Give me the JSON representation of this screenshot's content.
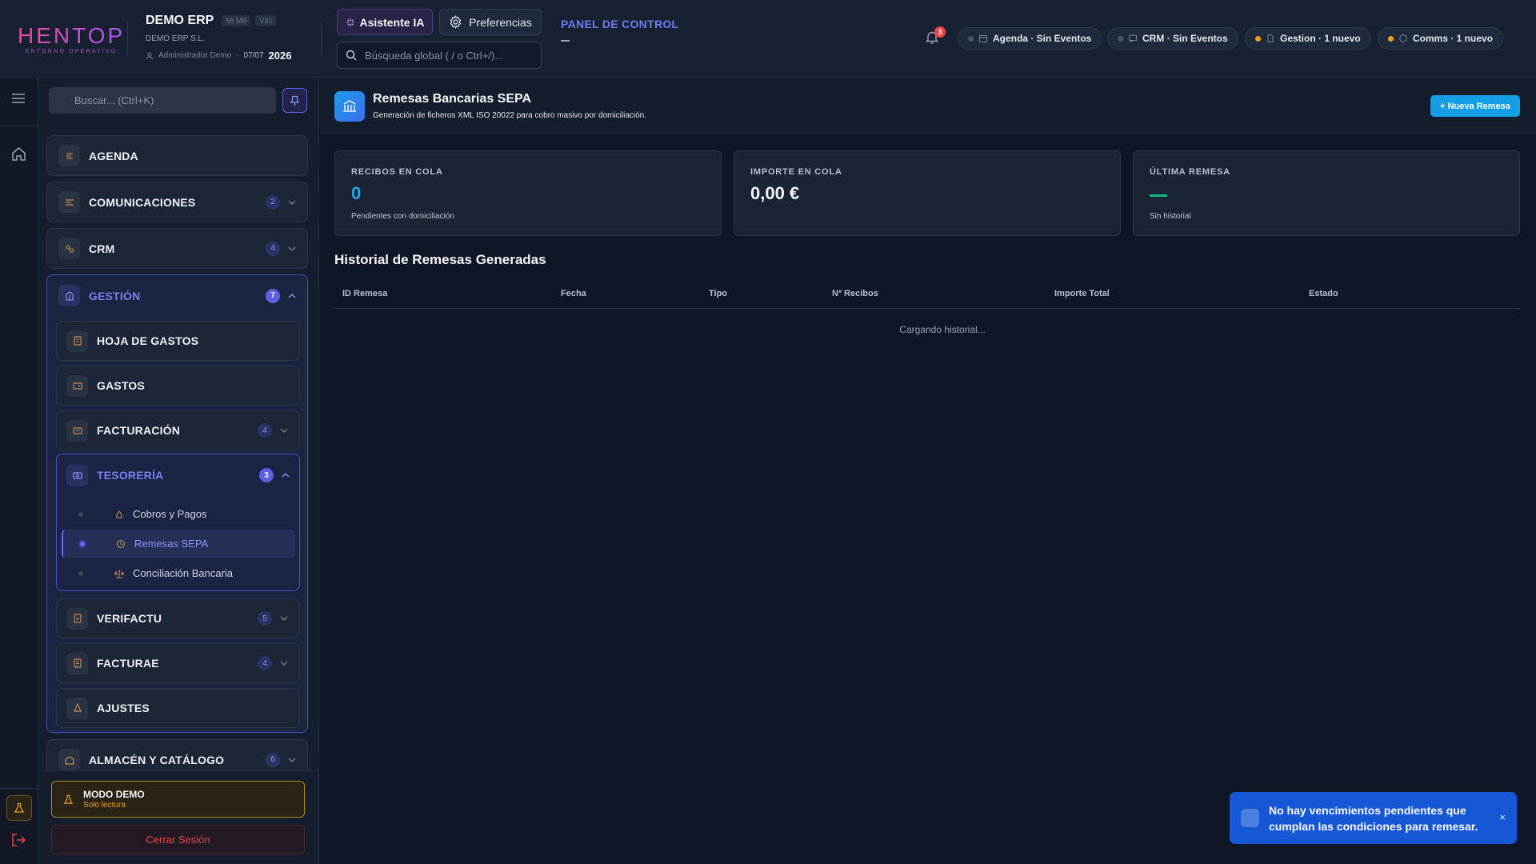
{
  "header": {
    "logo_text": "HENTOP",
    "logo_sub": "ENTORNO OPERATIVO",
    "company_name": "DEMO ERP",
    "size_tag": "58 MB",
    "version_tag": "V31",
    "legal_name": "DEMO ERP S.L.",
    "user": "Administrador Demo",
    "date": "07/07",
    "year": "2026",
    "ai_button": "Asistente IA",
    "prefs_button": "Preferencias",
    "search_placeholder": "Búsqueda global ( / o Ctrl+/)...",
    "panel_link": "PANEL DE CONTROL",
    "notif_count": "3",
    "pills": [
      {
        "label": "Agenda · Sin Eventos",
        "status": "idle"
      },
      {
        "label": "CRM · Sin Eventos",
        "status": "idle"
      },
      {
        "label": "Gestion · 1 nuevo",
        "status": "new"
      },
      {
        "label": "Comms · 1 nuevo",
        "status": "new"
      }
    ]
  },
  "sidebar": {
    "search_placeholder": "Buscar... (Ctrl+K)",
    "items": [
      {
        "label": "AGENDA",
        "count": ""
      },
      {
        "label": "COMUNICACIONES",
        "count": "2"
      },
      {
        "label": "CRM",
        "count": "4"
      }
    ],
    "gestion": {
      "label": "GESTIÓN",
      "count": "7",
      "children": [
        {
          "label": "HOJA DE GASTOS",
          "count": ""
        },
        {
          "label": "GASTOS",
          "count": ""
        },
        {
          "label": "FACTURACIÓN",
          "count": "4"
        }
      ],
      "tesoreria": {
        "label": "TESORERÍA",
        "count": "3",
        "leaves": [
          "Cobros y Pagos",
          "Remesas SEPA",
          "Conciliación Bancaria"
        ]
      },
      "after": [
        {
          "label": "VERIFACTU",
          "count": "5"
        },
        {
          "label": "FACTURAE",
          "count": "4"
        },
        {
          "label": "AJUSTES",
          "count": ""
        }
      ]
    },
    "almacen": {
      "label": "ALMACÉN Y CATÁLOGO",
      "count": "6"
    },
    "demo_title": "MODO DEMO",
    "demo_sub": "Solo lectura",
    "logout": "Cerrar Sesión"
  },
  "page": {
    "title": "Remesas Bancarias SEPA",
    "subtitle": "Generación de ficheros XML ISO 20022 para cobro masivo por domiciliación.",
    "new_button": "+ Nueva Remesa",
    "stats": [
      {
        "label": "RECIBOS EN COLA",
        "value": "0",
        "note": "Pendientes con domiciliación"
      },
      {
        "label": "IMPORTE EN COLA",
        "value": "0,00 €",
        "note": ""
      },
      {
        "label": "ÚLTIMA REMESA",
        "value": "",
        "note": "Sin historial"
      }
    ],
    "history_title": "Historial de Remesas Generadas",
    "columns": [
      "ID Remesa",
      "Fecha",
      "Tipo",
      "Nº Recibos",
      "Importe Total",
      "Estado"
    ],
    "loading": "Cargando historial..."
  },
  "toast": {
    "message": "No hay vencimientos pendientes que cumplan las condiciones para remesar.",
    "close": "×"
  },
  "colors": {
    "accent": "#6366f1",
    "primary_button": "#139ee6",
    "toast": "#1557d4",
    "demo": "#f0a020",
    "danger": "#ef4444"
  }
}
